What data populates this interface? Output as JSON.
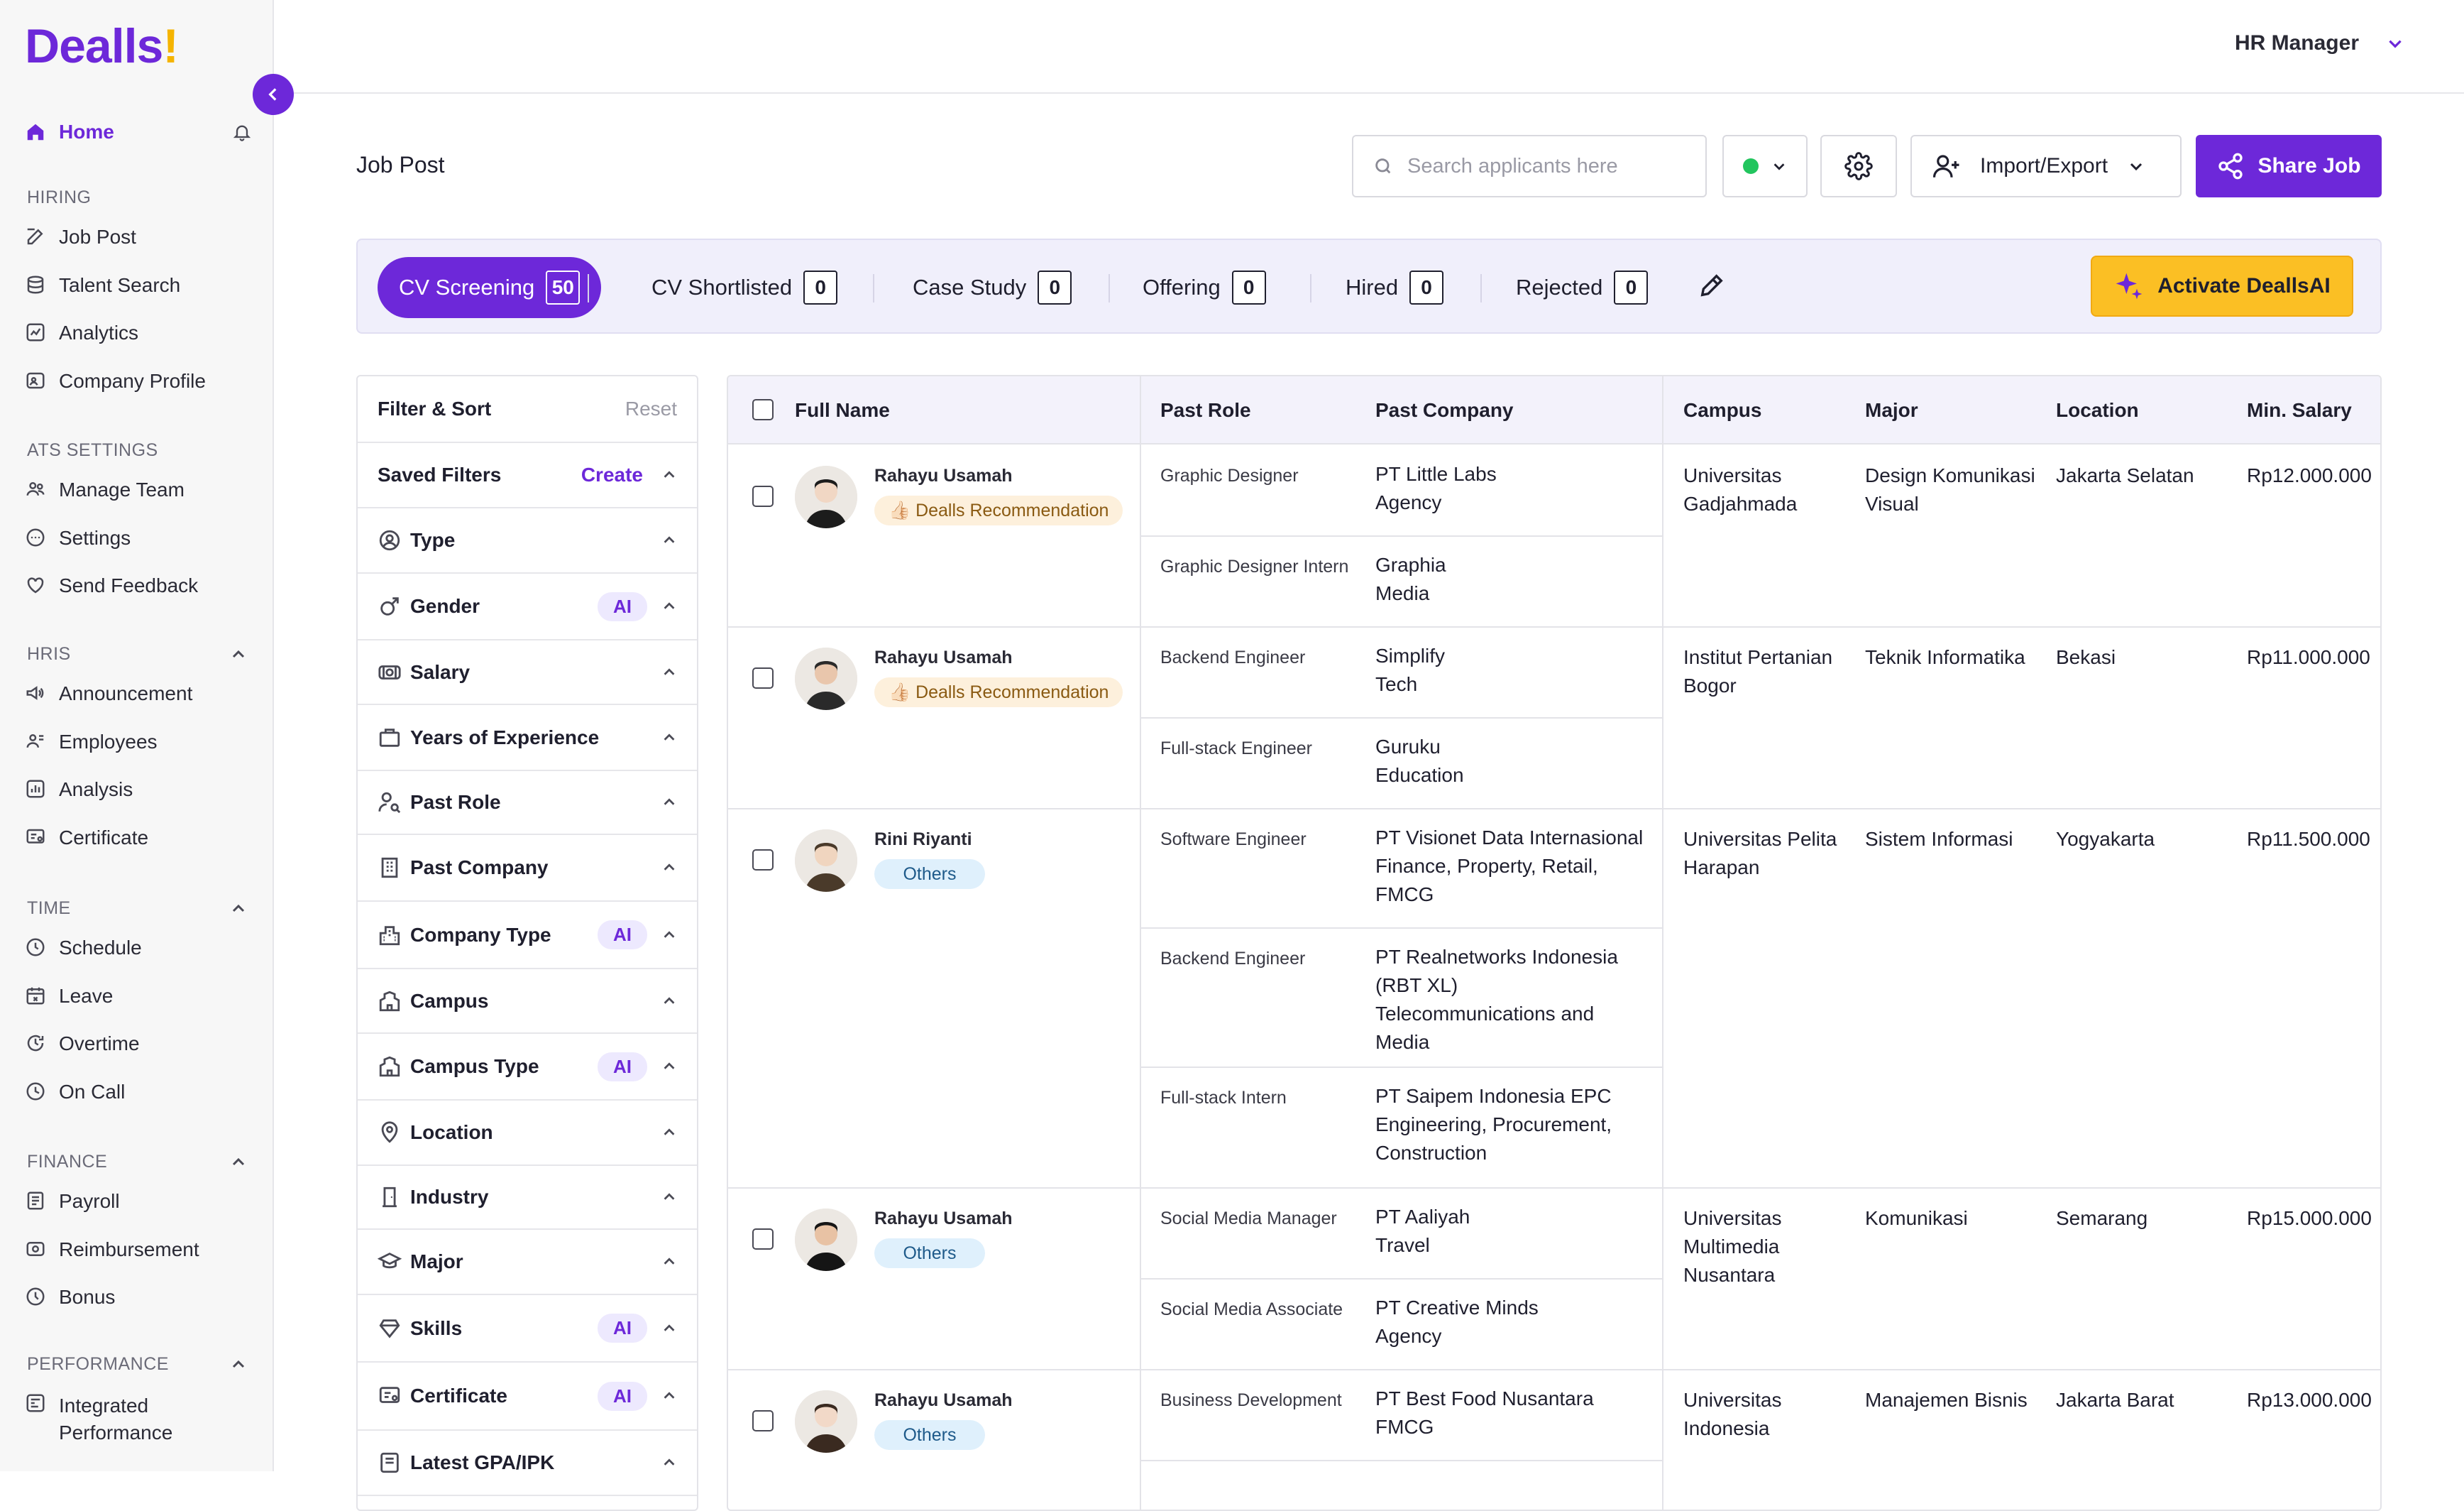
{
  "brand": {
    "name": "Dealls",
    "mark": "!",
    "primary": "#6d28d9",
    "accent": "#fbbf24"
  },
  "sidebar": {
    "home": "Home",
    "sections": [
      {
        "title": "HIRING",
        "collapsible": false,
        "items": [
          "Job Post",
          "Talent Search",
          "Analytics",
          "Company Profile"
        ]
      },
      {
        "title": "ATS SETTINGS",
        "collapsible": false,
        "items": [
          "Manage Team",
          "Settings",
          "Send Feedback"
        ]
      },
      {
        "title": "HRIS",
        "collapsible": true,
        "items": [
          "Announcement",
          "Employees",
          "Analysis",
          "Certificate"
        ]
      },
      {
        "title": "TIME",
        "collapsible": true,
        "items": [
          "Schedule",
          "Leave",
          "Overtime",
          "On Call"
        ]
      },
      {
        "title": "FINANCE",
        "collapsible": true,
        "items": [
          "Payroll",
          "Reimbursement",
          "Bonus"
        ]
      },
      {
        "title": "PERFORMANCE",
        "collapsible": true,
        "items": [
          "Integrated Performance"
        ]
      }
    ]
  },
  "header": {
    "user_role": "HR Manager"
  },
  "page": {
    "title": "Job Post"
  },
  "toolbar": {
    "search_placeholder": "Search applicants here",
    "import_export": "Import/Export",
    "share_job": "Share Job",
    "status_color": "#22c55e"
  },
  "stages": [
    {
      "label": "CV Screening",
      "count": "50",
      "active": true
    },
    {
      "label": "CV Shortlisted",
      "count": "0"
    },
    {
      "label": "Case Study",
      "count": "0"
    },
    {
      "label": "Offering",
      "count": "0"
    },
    {
      "label": "Hired",
      "count": "0"
    },
    {
      "label": "Rejected",
      "count": "0"
    }
  ],
  "activate_ai": "Activate DeallsAI",
  "filters": {
    "title": "Filter & Sort",
    "reset": "Reset",
    "saved_filters": "Saved Filters",
    "create": "Create",
    "ai_label": "AI",
    "items": [
      {
        "label": "Type",
        "icon": "person-circle-icon",
        "ai": false
      },
      {
        "label": "Gender",
        "icon": "gender-icon",
        "ai": true
      },
      {
        "label": "Salary",
        "icon": "money-icon",
        "ai": false
      },
      {
        "label": "Years of Experience",
        "icon": "briefcase-icon",
        "ai": false
      },
      {
        "label": "Past Role",
        "icon": "user-search-icon",
        "ai": false
      },
      {
        "label": "Past Company",
        "icon": "building-icon",
        "ai": false
      },
      {
        "label": "Company Type",
        "icon": "city-icon",
        "ai": true
      },
      {
        "label": "Campus",
        "icon": "campus-icon",
        "ai": false
      },
      {
        "label": "Campus Type",
        "icon": "campus-icon",
        "ai": true
      },
      {
        "label": "Location",
        "icon": "location-pin-icon",
        "ai": false
      },
      {
        "label": "Industry",
        "icon": "door-icon",
        "ai": false
      },
      {
        "label": "Major",
        "icon": "graduation-cap-icon",
        "ai": false
      },
      {
        "label": "Skills",
        "icon": "diamond-icon",
        "ai": true
      },
      {
        "label": "Certificate",
        "icon": "certificate-icon",
        "ai": true
      },
      {
        "label": "Latest GPA/IPK",
        "icon": "gpa-icon",
        "ai": false
      }
    ]
  },
  "table": {
    "columns": [
      "Full Name",
      "Past Role",
      "Past Company",
      "Campus",
      "Major",
      "Location",
      "Min. Salary"
    ],
    "rows": [
      {
        "name": "Rahayu Usamah",
        "badge": "👍🏻 Dealls Recommendation",
        "badge_type": "rec",
        "experience": [
          {
            "role": "Graphic Designer",
            "company": [
              "PT Little Labs",
              "Agency"
            ]
          },
          {
            "role": "Graphic Designer Intern",
            "company": [
              "Graphia",
              "Media"
            ]
          }
        ],
        "campus": [
          "Universitas",
          "Gadjahmada"
        ],
        "major": [
          "Design Komunikasi",
          "Visual"
        ],
        "location": "Jakarta Selatan",
        "salary": "Rp12.000.000"
      },
      {
        "name": "Rahayu Usamah",
        "badge": "👍🏻 Dealls Recommendation",
        "badge_type": "rec",
        "experience": [
          {
            "role": "Backend Engineer",
            "company": [
              "Simplify",
              "Tech"
            ]
          },
          {
            "role": "Full-stack Engineer",
            "company": [
              "Guruku",
              "Education"
            ]
          }
        ],
        "campus": [
          "Institut Pertanian",
          "Bogor"
        ],
        "major": [
          "Teknik Informatika"
        ],
        "location": "Bekasi",
        "salary": "Rp11.000.000"
      },
      {
        "name": "Rini Riyanti",
        "badge": "Others",
        "badge_type": "oth",
        "experience": [
          {
            "role": "Software Engineer",
            "company": [
              "PT Visionet Data Internasional",
              "Finance, Property, Retail,",
              "FMCG"
            ]
          },
          {
            "role": "Backend Engineer",
            "company": [
              "PT Realnetworks Indonesia",
              "(RBT XL)",
              "Telecommunications and",
              "Media"
            ]
          },
          {
            "role": "Full-stack Intern",
            "company": [
              "PT Saipem Indonesia EPC",
              "Engineering, Procurement,",
              "Construction"
            ]
          }
        ],
        "campus": [
          "Universitas Pelita",
          "Harapan"
        ],
        "major": [
          "Sistem Informasi"
        ],
        "location": "Yogyakarta",
        "salary": "Rp11.500.000"
      },
      {
        "name": "Rahayu Usamah",
        "badge": "Others",
        "badge_type": "oth",
        "experience": [
          {
            "role": "Social Media Manager",
            "company": [
              "PT Aaliyah",
              "Travel"
            ]
          },
          {
            "role": "Social Media Associate",
            "company": [
              "PT Creative Minds",
              "Agency"
            ]
          }
        ],
        "campus": [
          "Universitas",
          "Multimedia",
          "Nusantara"
        ],
        "major": [
          "Komunikasi"
        ],
        "location": "Semarang",
        "salary": "Rp15.000.000"
      },
      {
        "name": "Rahayu Usamah",
        "badge": "Others",
        "badge_type": "oth",
        "experience": [
          {
            "role": "Business Development",
            "company": [
              "PT Best Food Nusantara",
              "FMCG"
            ]
          }
        ],
        "campus": [
          "Universitas",
          "Indonesia"
        ],
        "major": [
          "Manajemen Bisnis"
        ],
        "location": "Jakarta Barat",
        "salary": "Rp13.000.000"
      }
    ]
  }
}
